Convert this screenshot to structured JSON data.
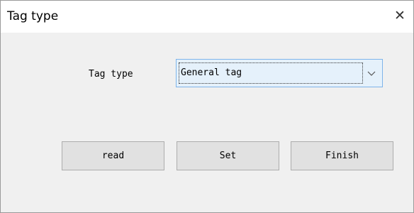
{
  "window": {
    "title": "Tag type",
    "close_glyph": "✕"
  },
  "form": {
    "tag_type_label": "Tag type",
    "tag_type_value": "General tag"
  },
  "buttons": {
    "read": "read",
    "set": "Set",
    "finish": "Finish"
  },
  "icons": {
    "close": "close-icon",
    "dropdown": "chevron-down-icon"
  },
  "colors": {
    "combo_focus_border": "#7eb4ea",
    "combo_focus_fill": "#e5f1fb",
    "button_fill": "#e1e1e1"
  }
}
